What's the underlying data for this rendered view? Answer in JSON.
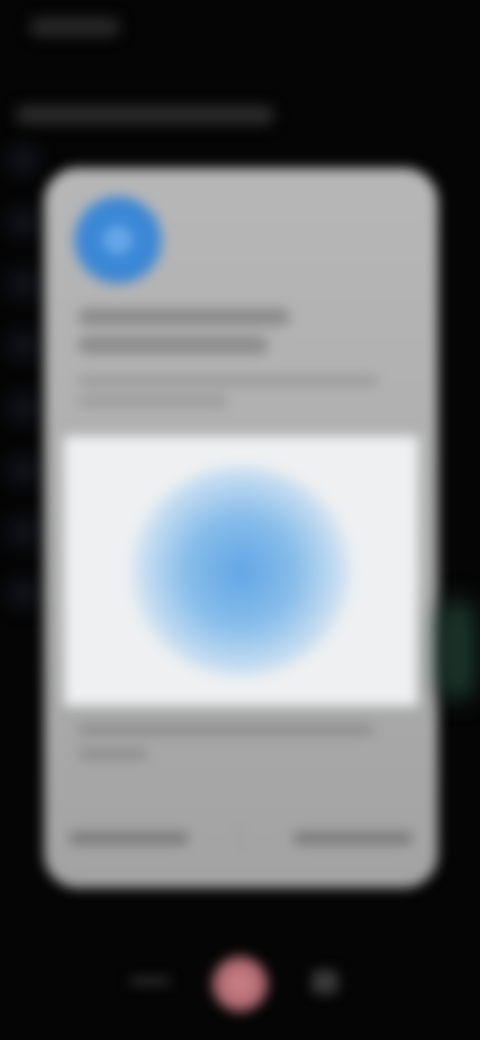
{
  "status_bar": {
    "time": ""
  },
  "header": {
    "title": ""
  },
  "dialog": {
    "icon": "blue-circle-icon",
    "title_line1": "",
    "title_line2": "",
    "description_line1": "",
    "description_line2": "",
    "illustration": "blue-glow-illustration",
    "footer_line1": "",
    "footer_line2": "",
    "secondary_button_label": "",
    "primary_button_label": ""
  },
  "bottom_controls": {
    "left_item": "menu-icon",
    "center_item": "record-button-icon",
    "right_item": "app-switch-icon"
  },
  "colors": {
    "background": "#050505",
    "card": "#b0b0b0",
    "accent_blue": "#3d8fe0",
    "record_button": "#c27a80"
  }
}
